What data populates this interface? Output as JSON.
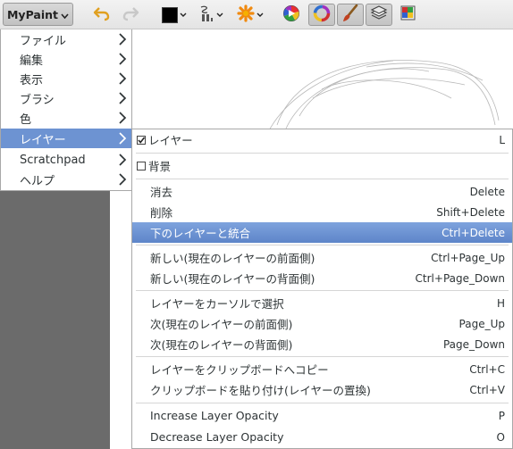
{
  "toolbar": {
    "app_button_label": "MyPaint",
    "icons": [
      "undo-icon",
      "redo-icon",
      "color-swatch",
      "brush-size-icon",
      "symmetry-icon",
      "color-wheel-icon",
      "color-ring-icon",
      "brush-icon",
      "layers-icon",
      "scratchpad-icon"
    ],
    "accent_color": "#6d93d2",
    "swatch_color": "#000000"
  },
  "main_menu": {
    "items": [
      {
        "label": "ファイル"
      },
      {
        "label": "編集"
      },
      {
        "label": "表示"
      },
      {
        "label": "ブラシ"
      },
      {
        "label": "色"
      },
      {
        "label": "レイヤー",
        "selected": true
      },
      {
        "label": "Scratchpad"
      },
      {
        "label": "ヘルプ"
      }
    ]
  },
  "layer_menu": {
    "toggle_layer": {
      "label": "レイヤー",
      "shortcut": "L",
      "checked": true
    },
    "toggle_background": {
      "label": "背景",
      "checked": false
    },
    "clear": {
      "label": "消去",
      "shortcut": "Delete"
    },
    "remove": {
      "label": "削除",
      "shortcut": "Shift+Delete"
    },
    "merge_down": {
      "label": "下のレイヤーと統合",
      "shortcut": "Ctrl+Delete",
      "highlighted": true
    },
    "new_above": {
      "label": "新しい(現在のレイヤーの前面側)",
      "shortcut": "Ctrl+Page_Up"
    },
    "new_below": {
      "label": "新しい(現在のレイヤーの背面側)",
      "shortcut": "Ctrl+Page_Down"
    },
    "pick_with_cursor": {
      "label": "レイヤーをカーソルで選択",
      "shortcut": "H"
    },
    "next_above": {
      "label": "次(現在のレイヤーの前面側)",
      "shortcut": "Page_Up"
    },
    "next_below": {
      "label": "次(現在のレイヤーの背面側)",
      "shortcut": "Page_Down"
    },
    "copy_to_clipboard": {
      "label": "レイヤーをクリップボードへコピー",
      "shortcut": "Ctrl+C"
    },
    "paste_from_clipboard": {
      "label": "クリップボードを貼り付け(レイヤーの置換)",
      "shortcut": "Ctrl+V"
    },
    "increase_opacity": {
      "label": "Increase Layer Opacity",
      "shortcut": "P"
    },
    "decrease_opacity": {
      "label": "Decrease Layer Opacity",
      "shortcut": "O"
    }
  }
}
